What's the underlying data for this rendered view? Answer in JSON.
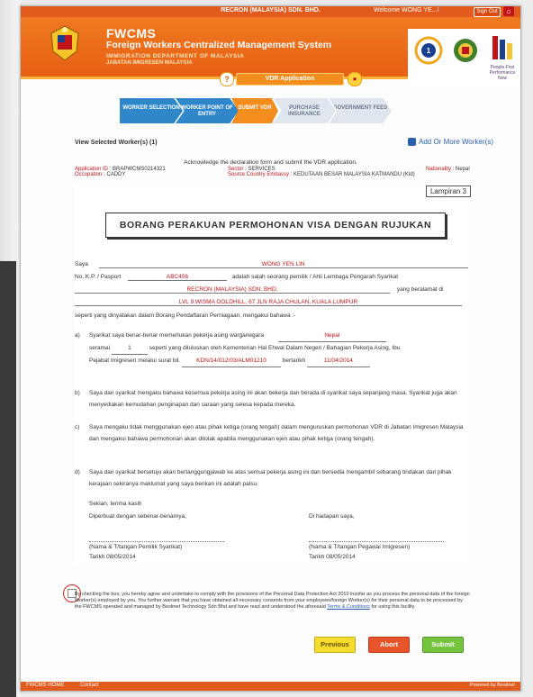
{
  "topbar": {
    "center": "RECRON (MALAYSIA) SDN. BHD.",
    "welcome": "Welcome WONG YE...!",
    "signout": "Sign Out"
  },
  "header": {
    "title": "FWCMS",
    "subtitle": "Foreign Workers Centralized Management System",
    "dept": "IMMIGRATION DEPARTMENT OF MALAYSIA",
    "dept2": "JABATAN IMIGRESEN MALAYSIA",
    "logo_right_text": "People First Performance Now"
  },
  "app_tab": {
    "number": "?",
    "label": "VDR Application"
  },
  "steps": [
    {
      "label": "WORKER SELECTION",
      "state": "done"
    },
    {
      "label": "WORKER POINT OF ENTRY",
      "state": "done"
    },
    {
      "label": "SUBMIT VDR",
      "state": "active"
    },
    {
      "label": "PURCHASE INSURANCE",
      "state": "todo"
    },
    {
      "label": "GOVERNMENT FEES",
      "state": "todo"
    }
  ],
  "view_selected": "View Selected Worker(s) (1)",
  "add_more": "Add Or More Worker(s)",
  "acknowledge": "Acknowledge the declaration form and submit the VDR application.",
  "info": {
    "app_id_label": "Application ID :",
    "app_id": "BRAPWCMS0214321",
    "occ_label": "Occupation :",
    "occ": "CADDY",
    "sector_label": "Sector :",
    "sector": "SERVICES",
    "embassy_label": "Source Country Embassy :",
    "embassy": "KEDUTAAN BESAR MALAYSIA KATMANDU (Ktd)",
    "nat_label": "Nationality :",
    "nat": "Nepal"
  },
  "form": {
    "lampiran": "Lampiran 3",
    "title": "BORANG PERAKUAN PERMOHONAN VISA DENGAN RUJUKAN",
    "saya_label": "Saya",
    "saya_value": "WONG YEN LIN",
    "kp_label": "No. K.P. / Pasport",
    "kp_value": "ABC456",
    "kp_suffix": "adalah salah seorang pemilik / Ahli Lembaga Pengarah Syarikat",
    "company": "RECRON (MALAYSIA) SDN. BHD.",
    "company_suffix": "yang beralamat di",
    "address": "LVL 9,WISMA GOLDHILL, 67 JLN RAJA CHULAN, KUALA LUMPUR",
    "declare": "seperti yang dinyatakan dalam Borang Pendaftaran Perniagaan, mengakui bahawa :-",
    "a_num": "a)",
    "a_text1": "Syarikat saya benar-benar memerlukan pekerja asing warganegara",
    "a_nat": "Nepal",
    "a_seramai": "seramai",
    "a_count": "1",
    "a_text2": "seperti yang diluluskan oleh Kementerian Hal Ehwal Dalam Negeri / Bahagian Pekerja Asing, Ibu",
    "a_text3": "Pejabat Imigresen melalui surat bil.",
    "a_ref": "KDN/14/012/03/ALM01210",
    "a_bertarikh": "bertarikh",
    "a_date": "11/04/2014",
    "b_num": "b)",
    "b_text": "Saya dan syarikat mengaku bahawa kesemua pekerja asing ini akan bekerja dan berada di syarikat saya sepanjang masa. Syarikat juga akan menyediakan kemudahan penginapan dan saraan yang selesa kepada mereka.",
    "c_num": "c)",
    "c_text": "Saya mengaku tidak menggunakan ejen atau pihak ketiga (orang tengah) dalam menguruskan permohonan VDR di Jabatan Imigresen Malaysia dan mengakui bahawa permohonan akan ditolak apabila menggunakan ejen atau pihak ketiga (orang tengah).",
    "d_num": "d)",
    "d_text": "Saya dan syarikat bersetuju akan bertanggungjawab ke atas semua pekerja asing ini dan bersedia mengambil sebarang tindakan dari pihak kerajaan sekiranya maklumat yang saya berikan ini adalah palsu.",
    "sekian": "Sekian, terima kasih",
    "diperbuat": "Diperbuat dengan sebenar-benarnya,",
    "dihadapan": "Di hadapan saya,",
    "sig_left": "(Nama & T/tangan Pemilik Syarikat)",
    "sig_right": "(Nama & T/tangan Pegawai Imigresen)",
    "tarikh_left": "Tarikh  08/05/2014",
    "tarikh_right": "Tarikh  08/05/2014"
  },
  "consent": {
    "text": "By checking the box, you hereby agree and undertake to comply with the provisions of the Personal Data Protection Act 2010 insofar as you process the personal data of the foreign Worker(s) employed by you. You further warrant that you have obtained all necessary consents from your employees/foreign Worker(s) for their personal data to be processed by the FWCMS operated and managed by Bestinet Technology Sdn Bhd and have read and understood the aforesaid",
    "link": "Terms & Conditions",
    "tail": "for using this facility."
  },
  "buttons": {
    "previous": "Previous",
    "abort": "Abort",
    "submit": "Submit"
  },
  "footer": {
    "home": "FWCMS HOME",
    "contact": "Contact",
    "powered": "Powered by Bestinet"
  }
}
